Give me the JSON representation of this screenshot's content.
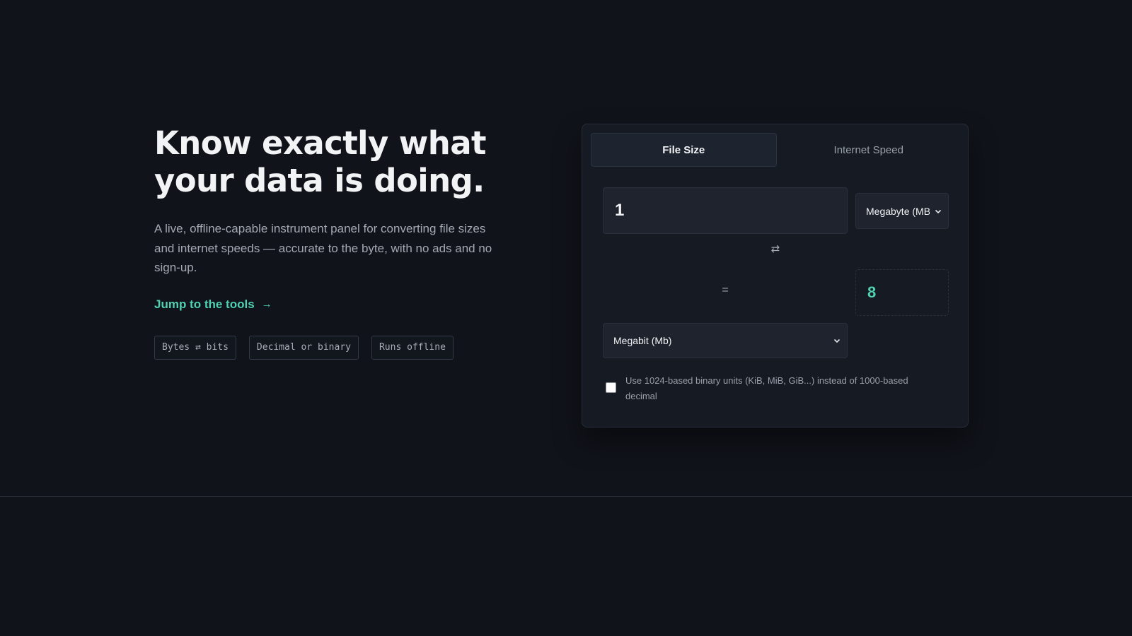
{
  "hero": {
    "title_line1": "Know exactly what",
    "title_line2": "your data is doing.",
    "lede": "A live, offline-capable instrument panel for converting file sizes and internet speeds — accurate to the byte, with no ads and no sign-up.",
    "cta_label": "Jump to the tools",
    "cta_icon": "→",
    "chips": [
      "Bytes ⇄ bits",
      "Decimal or binary",
      "Runs offline"
    ]
  },
  "converter": {
    "tabs": [
      {
        "label": "File Size",
        "active": true
      },
      {
        "label": "Internet Speed",
        "active": false
      }
    ],
    "amount_value": "1",
    "from_unit": "Megabyte (MB)",
    "swap_icon": "⇄",
    "equals": "=",
    "result_value": "8",
    "to_unit": "Megabit (Mb)",
    "binary_checked": false,
    "binary_label": "Use 1024-based binary units (KiB, MiB, GiB...) instead of 1000-based decimal"
  },
  "colors": {
    "background": "#10131a",
    "accent": "#4fd1b2",
    "panel": "#161a22"
  }
}
